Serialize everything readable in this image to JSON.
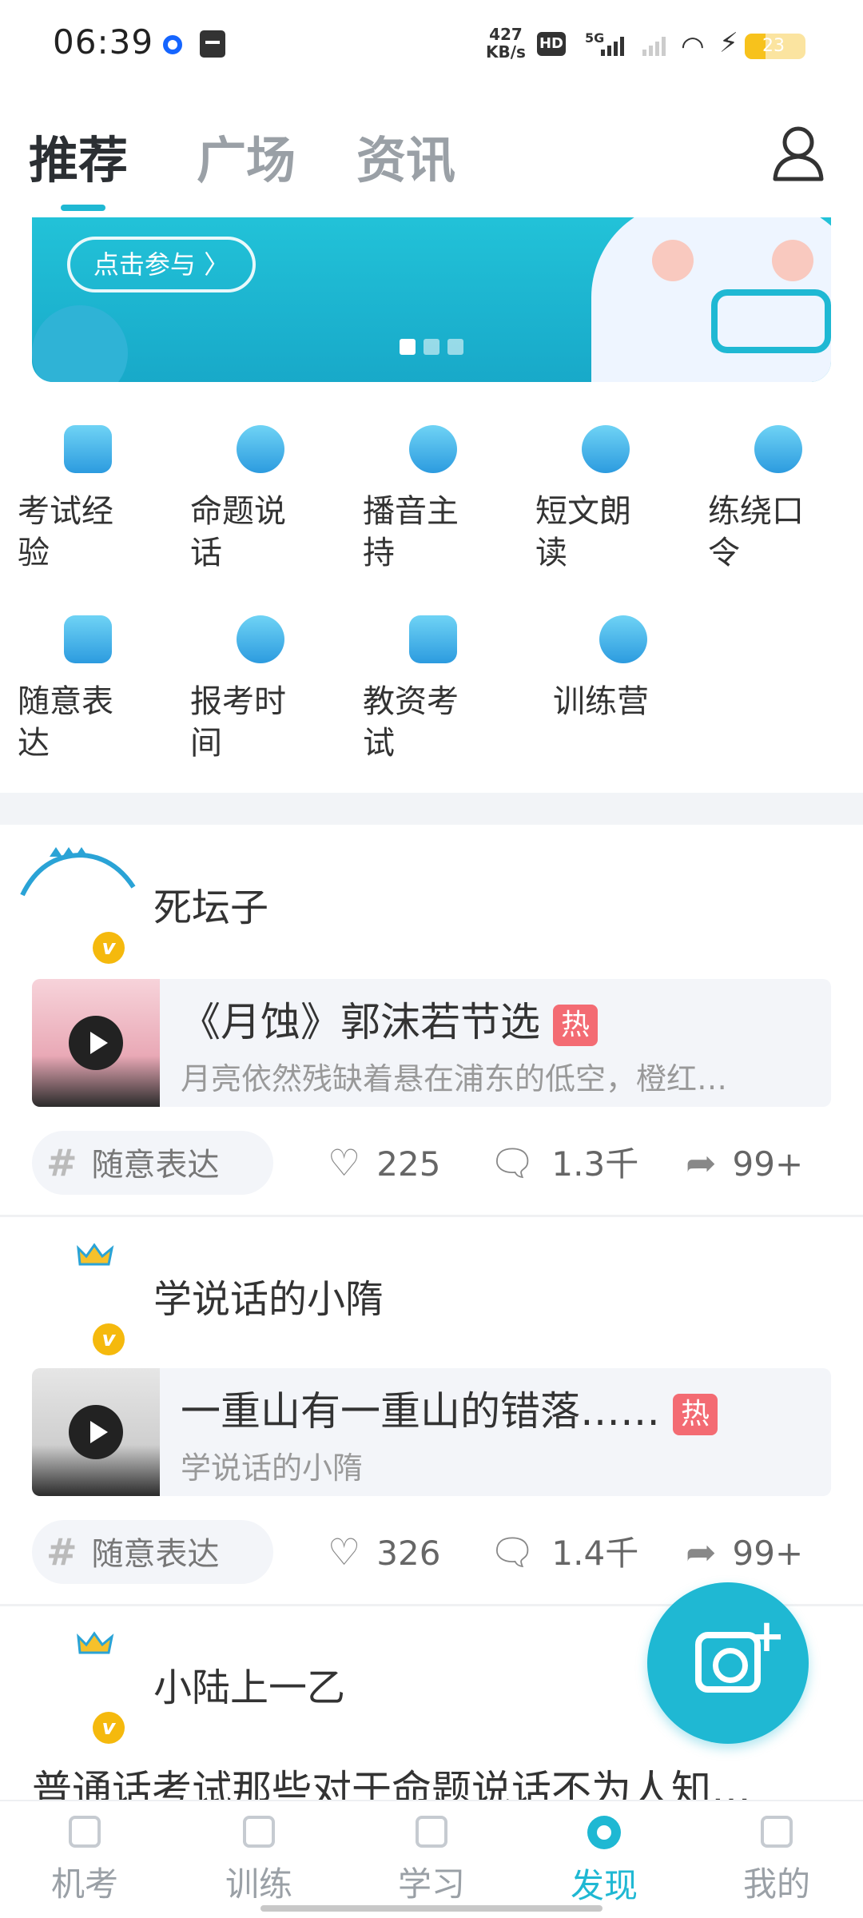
{
  "status_bar": {
    "time": "06:39",
    "net_speed_value": "427",
    "net_speed_unit": "KB/s",
    "hd_label": "HD",
    "network_label": "5G",
    "battery_level": "23"
  },
  "top_tabs": [
    {
      "label": "推荐",
      "active": true
    },
    {
      "label": "广场",
      "active": false
    },
    {
      "label": "资讯",
      "active": false
    }
  ],
  "banner": {
    "button_label": "点击参与 〉",
    "page_count": 3,
    "active_page": 1
  },
  "categories": [
    {
      "label": "考试经验",
      "icon": "notebook-icon"
    },
    {
      "label": "命题说话",
      "icon": "chat-face-icon"
    },
    {
      "label": "播音主持",
      "icon": "microphone-icon"
    },
    {
      "label": "短文朗读",
      "icon": "disc-icon"
    },
    {
      "label": "练绕口令",
      "icon": "film-reel-icon"
    },
    {
      "label": "随意表达",
      "icon": "message-icon"
    },
    {
      "label": "报考时间",
      "icon": "alarm-clock-icon"
    },
    {
      "label": "教资考试",
      "icon": "folder-icon"
    },
    {
      "label": "训练营",
      "icon": "headset-icon"
    }
  ],
  "posts": [
    {
      "author": "死坛子",
      "badge": "v",
      "title": "《月蚀》郭沫若节选",
      "hot_label": "热",
      "subtitle": "月亮依然残缺着悬在浦东的低空，橙红…",
      "tag": "随意表达",
      "likes": "225",
      "comments": "1.3千",
      "shares": "99+"
    },
    {
      "author": "学说话的小隋",
      "badge": "v",
      "title": "一重山有一重山的错落……",
      "hot_label": "热",
      "subtitle": "学说话的小隋",
      "tag": "随意表达",
      "likes": "326",
      "comments": "1.4千",
      "shares": "99+"
    },
    {
      "author": "小陆上一乙",
      "badge": "v",
      "text": "普通话考试那些对于命题说话不为人知…"
    }
  ],
  "bottom_nav": [
    {
      "label": "机考",
      "active": false
    },
    {
      "label": "训练",
      "active": false
    },
    {
      "label": "学习",
      "active": false
    },
    {
      "label": "发现",
      "active": true
    },
    {
      "label": "我的",
      "active": false
    }
  ],
  "colors": {
    "accent": "#1fb8d3",
    "hot": "#f36b73",
    "badge": "#f5b90d"
  }
}
